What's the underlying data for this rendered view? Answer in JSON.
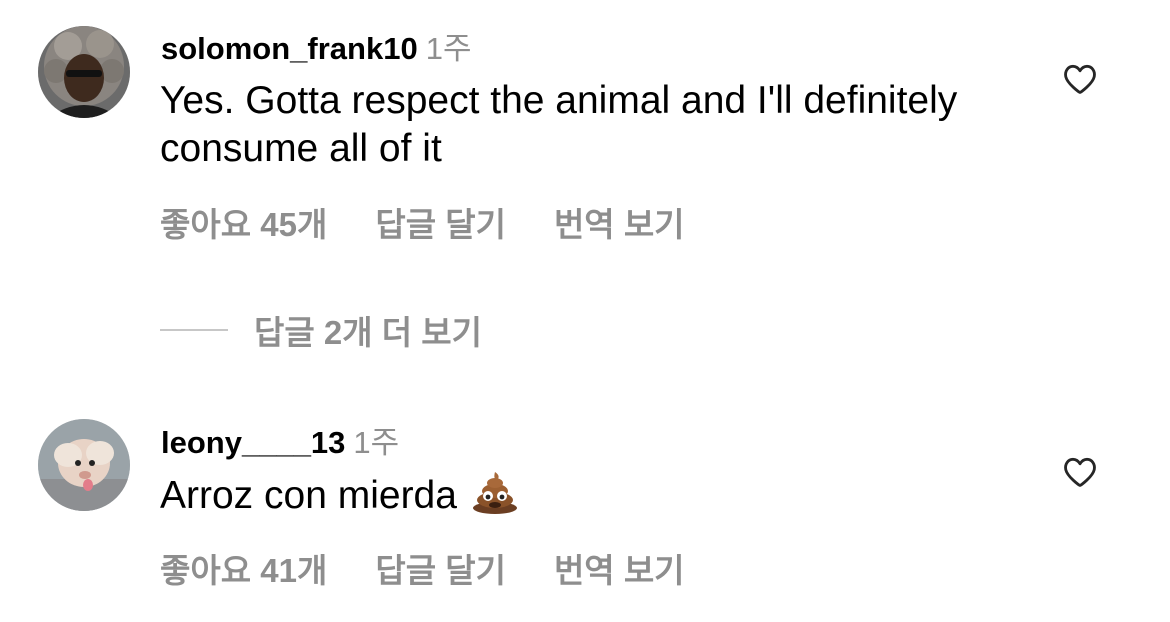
{
  "comments": [
    {
      "username": "solomon_frank10",
      "time": "1주",
      "text": "Yes. Gotta respect the animal and I'll definitely consume all of it",
      "likes_label": "좋아요 45개",
      "reply_label": "답글 달기",
      "translate_label": "번역 보기",
      "icons": {
        "like": "heart-outline-icon"
      }
    },
    {
      "username": "leony____13",
      "time": "1주",
      "text": "Arroz con mierda",
      "emoji": "pile-of-poo-emoji",
      "likes_label": "좋아요 41개",
      "reply_label": "답글 달기",
      "translate_label": "번역 보기",
      "icons": {
        "like": "heart-outline-icon"
      }
    }
  ],
  "view_replies_label": "답글 2개 더 보기",
  "colors": {
    "secondary_text": "#8e8e8e",
    "divider": "#c7c7c7",
    "primary_text": "#000000"
  }
}
